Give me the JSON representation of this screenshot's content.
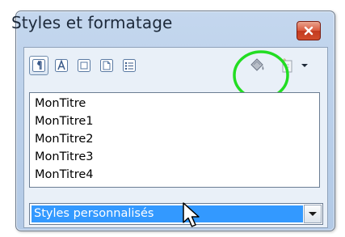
{
  "window": {
    "title": "Styles et formatage"
  },
  "toolbar": {
    "buttons": [
      {
        "icon": "paragraph-styles-icon",
        "active": true
      },
      {
        "icon": "character-styles-icon",
        "active": false
      },
      {
        "icon": "frame-styles-icon",
        "active": false
      },
      {
        "icon": "page-styles-icon",
        "active": false
      },
      {
        "icon": "list-styles-icon",
        "active": false
      },
      {
        "icon": "fill-format-mode-icon",
        "active": false
      },
      {
        "icon": "new-style-from-selection-icon",
        "active": false
      },
      {
        "icon": "dropdown-arrow-icon",
        "active": false
      }
    ]
  },
  "style_list": {
    "items": [
      "MonTitre",
      "MonTitre1",
      "MonTitre2",
      "MonTitre3",
      "MonTitre4"
    ]
  },
  "filter": {
    "selected": "Styles personnalisés"
  },
  "colors": {
    "selection": "#3399ff",
    "annotation_circle": "#22dd22",
    "close_button": "#d24c2b"
  }
}
